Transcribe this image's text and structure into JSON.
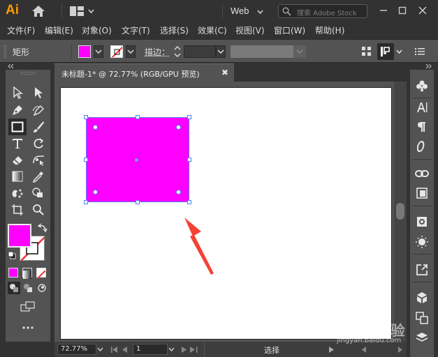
{
  "app": {
    "logo": "Ai",
    "workspace": "Web",
    "search_placeholder": "搜索 Adobe Stock"
  },
  "menu": [
    "文件(F)",
    "编辑(E)",
    "对象(O)",
    "文字(T)",
    "选择(S)",
    "效果(C)",
    "视图(V)",
    "窗口(W)",
    "帮助(H)"
  ],
  "control": {
    "tool_name": "矩形",
    "stroke_label": "描边：",
    "fill_color": "#ff00ff"
  },
  "document": {
    "tab_title": "未标题-1* @ 72.77% (RGB/GPU 预览)",
    "close_glyph": "✖"
  },
  "status": {
    "zoom": "72.77%",
    "page": "1",
    "text": "选择"
  },
  "watermark": {
    "brand": "Baidu经验",
    "url": "jingyan.baidu.com"
  },
  "colors": {
    "fill": "#ff00ff",
    "selection": "#4f7bff",
    "annotation_arrow": "#f44336",
    "logo": "#ff9a00"
  },
  "right_panel_icons": [
    "club-icon",
    "character-icon",
    "paragraph-icon",
    "opentype-icon",
    "links-icon",
    "artboards-icon",
    "image-trace-icon",
    "appearance-icon",
    "export-icon",
    "3d-cube-icon",
    "transform-icon",
    "layers-icon"
  ]
}
